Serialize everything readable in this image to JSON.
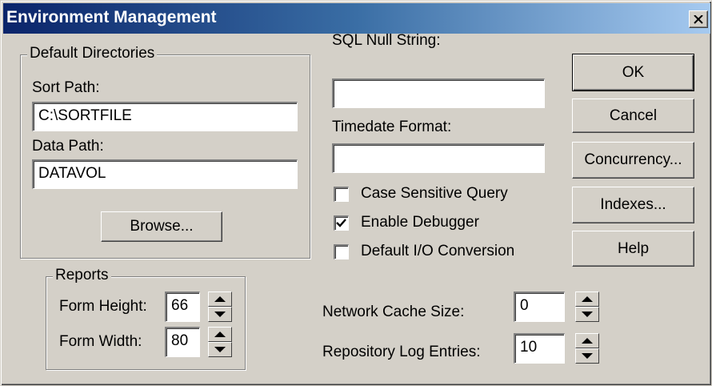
{
  "window": {
    "title": "Environment Management",
    "close_icon": "close-icon"
  },
  "default_directories": {
    "legend": "Default Directories",
    "sort_path_label": "Sort Path:",
    "sort_path_value": "C:\\SORTFILE",
    "data_path_label": "Data Path:",
    "data_path_value": "DATAVOL",
    "browse_label": "Browse..."
  },
  "sql_null_string": {
    "label": "SQL Null String:",
    "value": ""
  },
  "timedate_format": {
    "label": "Timedate Format:",
    "value": ""
  },
  "options": [
    {
      "label": "Case Sensitive Query",
      "checked": false
    },
    {
      "label": "Enable Debugger",
      "checked": true
    },
    {
      "label": "Default I/O Conversion",
      "checked": false
    }
  ],
  "buttons": {
    "ok": "OK",
    "cancel": "Cancel",
    "concurrency": "Concurrency...",
    "indexes": "Indexes...",
    "help": "Help"
  },
  "reports": {
    "legend": "Reports",
    "form_height_label": "Form Height:",
    "form_height_value": "66",
    "form_width_label": "Form Width:",
    "form_width_value": "80"
  },
  "network_cache_size": {
    "label": "Network Cache Size:",
    "value": "0"
  },
  "repository_log_entries": {
    "label": "Repository Log Entries:",
    "value": "10"
  }
}
